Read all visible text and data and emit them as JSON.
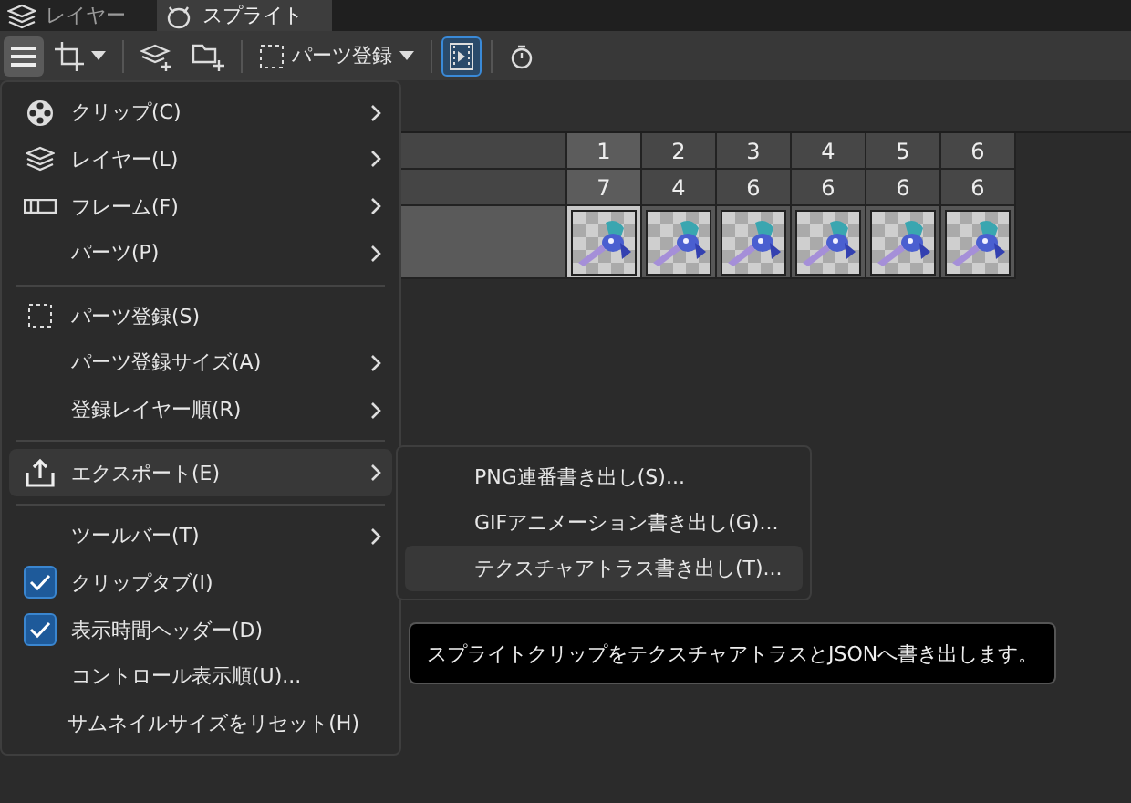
{
  "tabs": [
    {
      "label": "レイヤー",
      "selected": false
    },
    {
      "label": "スプライト",
      "selected": true
    }
  ],
  "toolbar": [
    {
      "kind": "menu",
      "active": true
    },
    {
      "kind": "crop",
      "active": false
    },
    {
      "kind": "separator"
    },
    {
      "kind": "layers",
      "active": false
    },
    {
      "kind": "folder",
      "active": false
    },
    {
      "kind": "separator"
    },
    {
      "kind": "parts",
      "label": "パーツ登録",
      "active": false
    },
    {
      "kind": "separator"
    },
    {
      "kind": "film",
      "active": true
    },
    {
      "kind": "separator"
    },
    {
      "kind": "timer",
      "active": false
    }
  ],
  "frames": [
    {
      "number": "1",
      "duration": "7",
      "selected": true
    },
    {
      "number": "2",
      "duration": "4",
      "selected": false
    },
    {
      "number": "3",
      "duration": "6",
      "selected": false
    },
    {
      "number": "4",
      "duration": "6",
      "selected": false
    },
    {
      "number": "5",
      "duration": "6",
      "selected": false
    },
    {
      "number": "6",
      "duration": "6",
      "selected": false
    }
  ],
  "menu": [
    [
      {
        "kind": "command",
        "label": "クリップ(C)",
        "submenu": true,
        "selected": false
      },
      {
        "kind": "command",
        "label": "レイヤー(L)",
        "submenu": true,
        "selected": false
      },
      {
        "kind": "command",
        "label": "フレーム(F)",
        "submenu": true,
        "selected": false
      },
      {
        "kind": "command",
        "label": "パーツ(P)",
        "submenu": true,
        "selected": false
      }
    ],
    [
      {
        "kind": "command",
        "label": "パーツ登録(S)",
        "submenu": false,
        "selected": false
      },
      {
        "kind": "command",
        "label": "パーツ登録サイズ(A)",
        "submenu": true,
        "selected": false
      },
      {
        "kind": "command",
        "label": "登録レイヤー順(R)",
        "submenu": true,
        "selected": false
      }
    ],
    [
      {
        "kind": "command",
        "label": "エクスポート(E)",
        "submenu": true,
        "selected": true
      }
    ],
    [
      {
        "kind": "command",
        "label": "ツールバー(T)",
        "submenu": true,
        "selected": false
      },
      {
        "kind": "check",
        "label": "クリップタブ(I)",
        "submenu": false,
        "selected": false,
        "checked": true
      },
      {
        "kind": "check",
        "label": "表示時間ヘッダー(D)",
        "submenu": false,
        "selected": false,
        "checked": true
      },
      {
        "kind": "command",
        "label": "コントロール表示順(U)...",
        "submenu": false,
        "selected": false
      },
      {
        "kind": "command",
        "label": "サムネイルサイズをリセット(H)",
        "submenu": false,
        "selected": false
      }
    ]
  ],
  "submenu": [
    {
      "label": "PNG連番書き出し(S)...",
      "selected": false
    },
    {
      "label": "GIFアニメーション書き出し(G)...",
      "selected": false
    },
    {
      "label": "テクスチャアトラス書き出し(T)...",
      "selected": true
    }
  ],
  "tooltip": "スプライトクリップをテクスチャアトラスとJSONへ書き出します。"
}
